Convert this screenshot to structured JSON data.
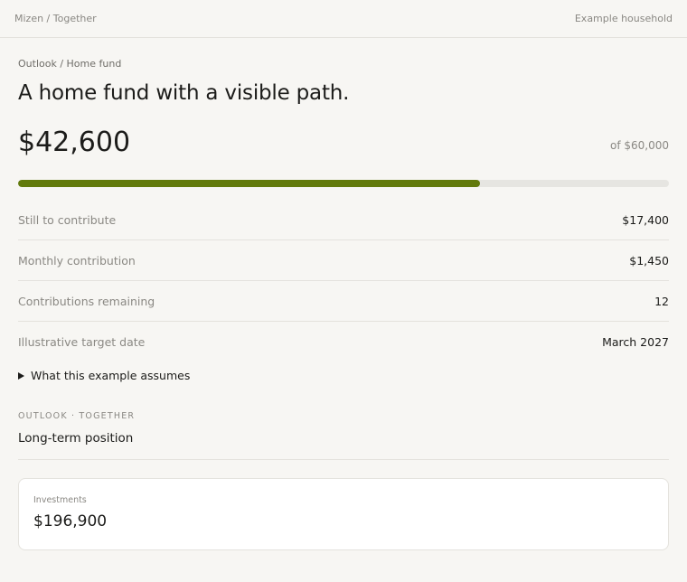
{
  "topbar": {
    "brand": "Mizen / Together",
    "household": "Example household"
  },
  "breadcrumb": "Outlook / Home fund",
  "title": "A home fund with a visible path.",
  "amount": "$42,600",
  "target": "of $60,000",
  "progress": {
    "fraction": 0.71
  },
  "stats": [
    {
      "label": "Still to contribute",
      "value": "$17,400"
    },
    {
      "label": "Monthly contribution",
      "value": "$1,450"
    },
    {
      "label": "Contributions remaining",
      "value": "12"
    },
    {
      "label": "Illustrative target date",
      "value": "March 2027"
    }
  ],
  "assumes_label": "What this example assumes",
  "outlook": {
    "eyebrow": "OUTLOOK · TOGETHER",
    "title": "Long-term position"
  },
  "investments": {
    "label": "Investments",
    "value": "$196,900"
  },
  "colors": {
    "accent": "#627a0c",
    "track": "#e6e5e1"
  }
}
